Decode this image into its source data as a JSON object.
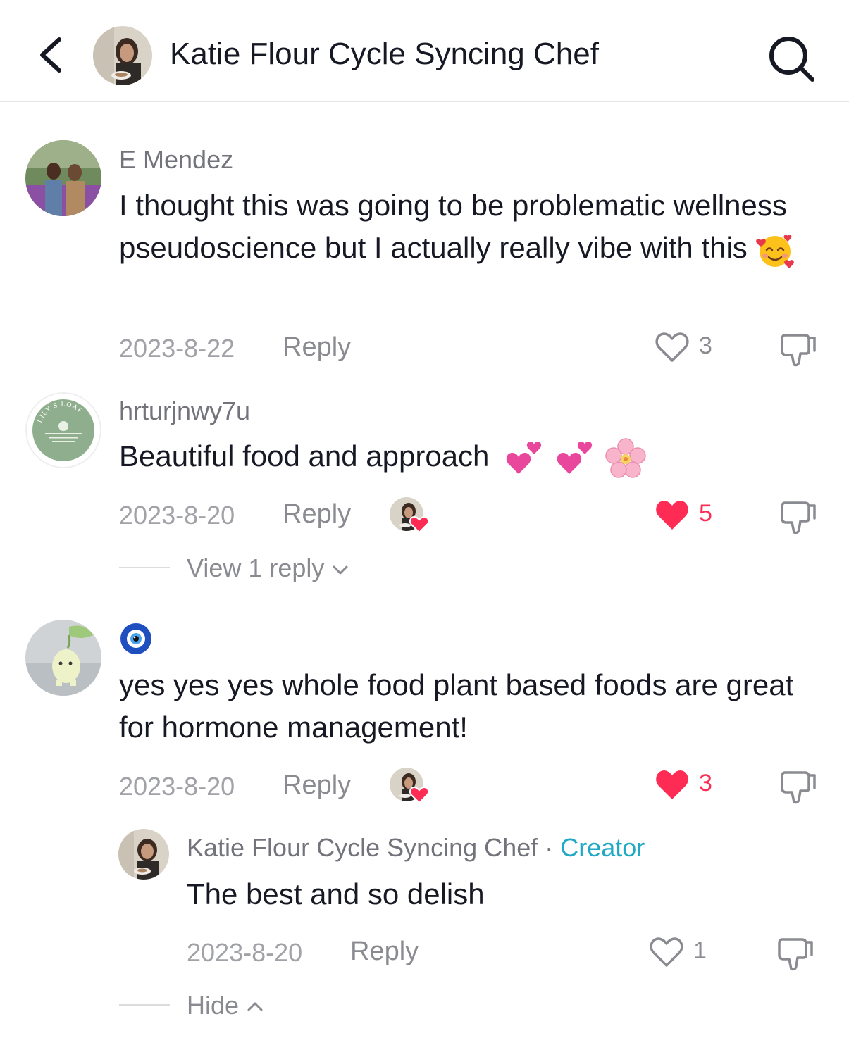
{
  "header": {
    "title": "Katie Flour Cycle Syncing Chef"
  },
  "comments": [
    {
      "username": "E Mendez",
      "text": "I thought this was going to be problematic wellness pseudoscience but I actually really vibe with this",
      "emoji": "smiling-face-with-hearts",
      "date": "2023-8-22",
      "reply_label": "Reply",
      "likes": "3",
      "liked": false
    },
    {
      "username": "hrturjnwy7u",
      "avatar_text": "LILY'S LOAF",
      "text": "Beautiful food and approach",
      "emoji": "two-hearts, two-hearts, cherry-blossom",
      "date": "2023-8-20",
      "reply_label": "Reply",
      "likes": "5",
      "liked": true,
      "creator_liked": true,
      "view_replies_label": "View 1 reply"
    },
    {
      "username_emoji": "nazar-amulet",
      "text": "yes yes yes whole food plant based foods are great for hormone management!",
      "date": "2023-8-20",
      "reply_label": "Reply",
      "likes": "3",
      "liked": true,
      "creator_liked": true,
      "replies": [
        {
          "username": "Katie Flour Cycle Syncing Chef",
          "separator": "·",
          "badge": "Creator",
          "text": "The best and so delish",
          "date": "2023-8-20",
          "reply_label": "Reply",
          "likes": "1",
          "liked": false
        }
      ],
      "hide_label": "Hide"
    }
  ],
  "colors": {
    "text_primary": "#161823",
    "text_secondary": "#73747b",
    "meta": "#a1a2a7",
    "liked_heart": "#fe2c55",
    "creator_badge": "#20a8c4"
  },
  "icons": [
    "back-chevron-icon",
    "search-icon",
    "heart-outline-icon",
    "heart-filled-icon",
    "dislike-icon",
    "chevron-down-icon",
    "chevron-up-icon"
  ]
}
